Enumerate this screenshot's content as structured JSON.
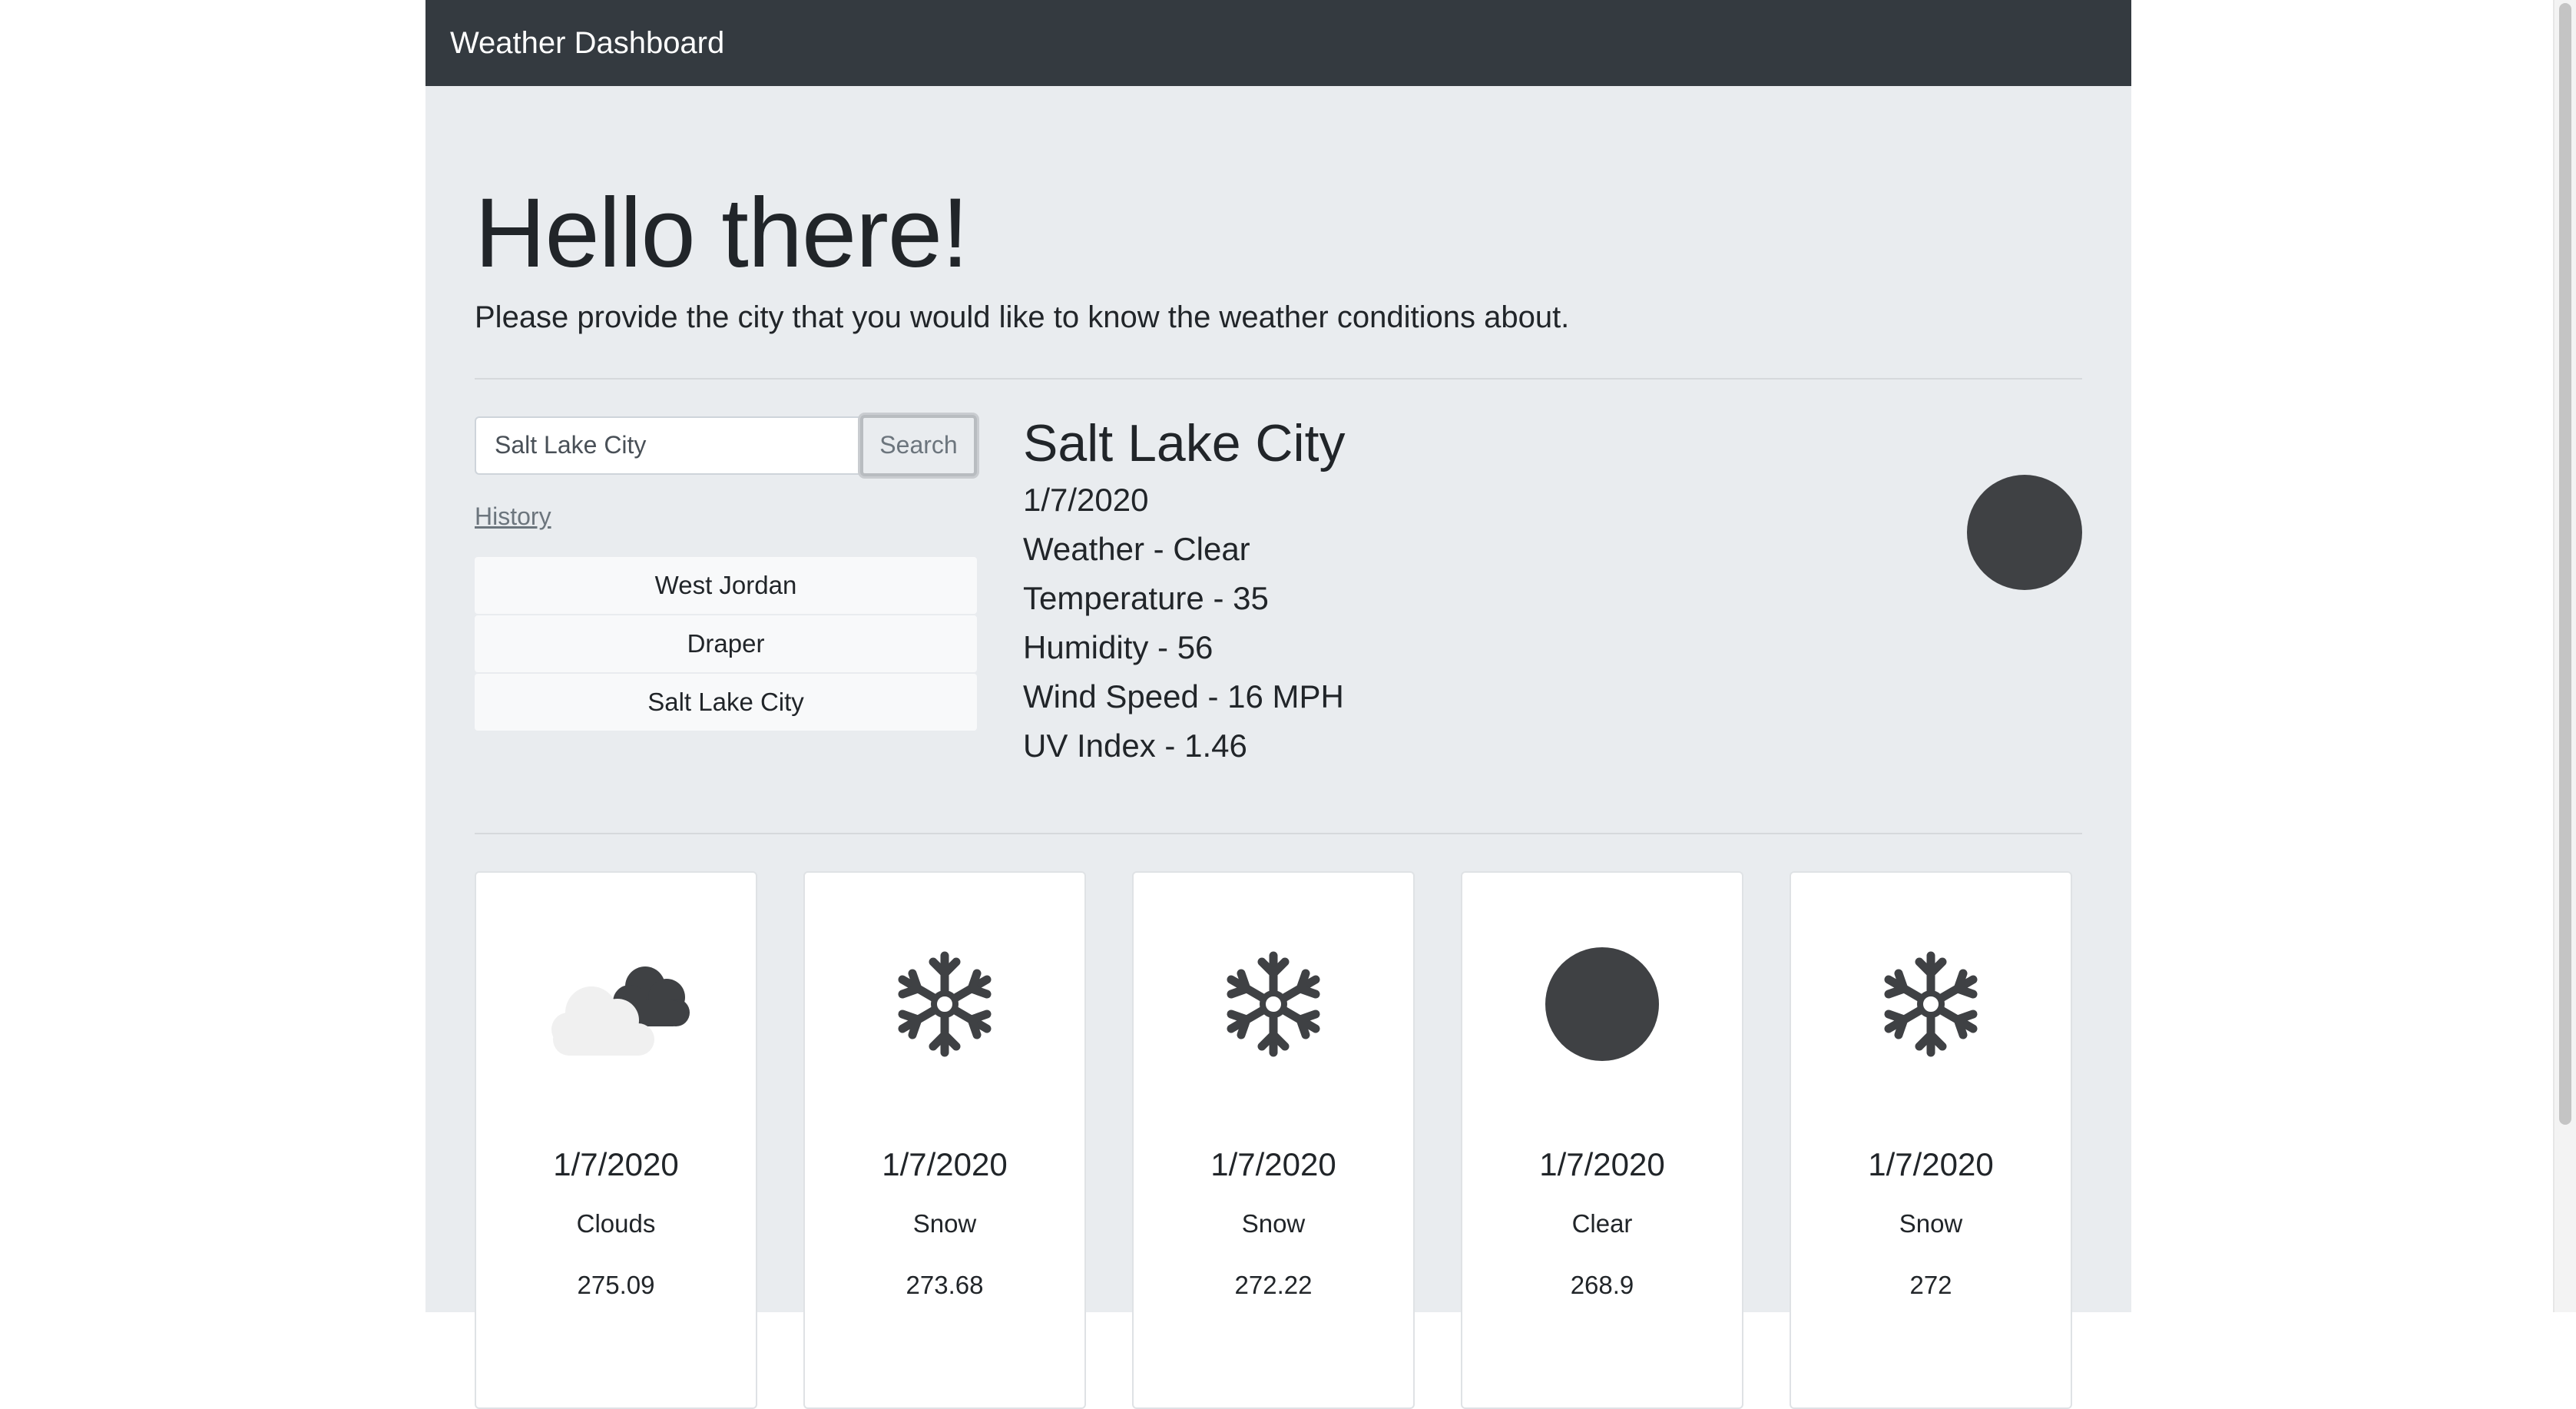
{
  "navbar": {
    "brand": "Weather Dashboard"
  },
  "hero": {
    "heading": "Hello there!",
    "lead": "Please provide the city that you would like to know the weather conditions about."
  },
  "search": {
    "value": "Salt Lake City",
    "button_label": "Search"
  },
  "history": {
    "link_label": "History",
    "items": [
      "West Jordan",
      "Draper",
      "Salt Lake City"
    ]
  },
  "current": {
    "city": "Salt Lake City",
    "date": "1/7/2020",
    "weather": "Weather - Clear",
    "temperature": "Temperature - 35",
    "humidity": "Humidity - 56",
    "wind": "Wind Speed - 16 MPH",
    "uv": "UV Index - 1.46",
    "icon": "clear-sun-icon"
  },
  "forecast": [
    {
      "date": "1/7/2020",
      "desc": "Clouds",
      "temp": "275.09",
      "icon": "clouds-icon"
    },
    {
      "date": "1/7/2020",
      "desc": "Snow",
      "temp": "273.68",
      "icon": "snowflake-icon"
    },
    {
      "date": "1/7/2020",
      "desc": "Snow",
      "temp": "272.22",
      "icon": "snowflake-icon"
    },
    {
      "date": "1/7/2020",
      "desc": "Clear",
      "temp": "268.9",
      "icon": "clear-sun-icon"
    },
    {
      "date": "1/7/2020",
      "desc": "Snow",
      "temp": "272",
      "icon": "snowflake-icon"
    }
  ],
  "colors": {
    "navbar_bg": "#343a40",
    "jumbotron_bg": "#e9ecef",
    "icon_fill": "#3f4144"
  }
}
